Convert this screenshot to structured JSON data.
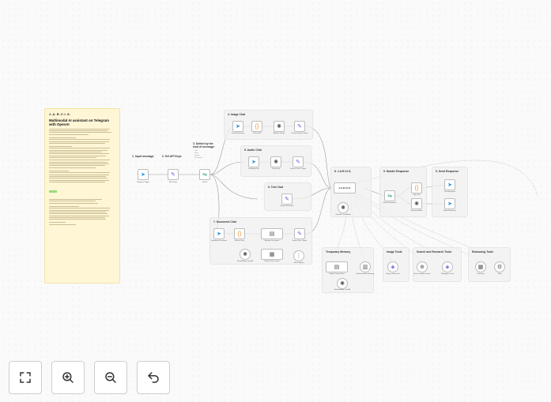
{
  "note": {
    "brand": "J.A.R.V.I.S.",
    "title": "Multimodal AI assistant on Telegram with OpenAI"
  },
  "sections": {
    "input_message": "1. Input message",
    "set_api_keys": "2. Set API Keys",
    "switch": "3. Switch by the kind of message:",
    "image_chat": "4. Image Chat",
    "audio_chat": "5. Audio Chat",
    "text_chat": "6. Text Chat",
    "document_chat": "7. Document Chat",
    "jarvis": "8. J.A.R.V.I.S.",
    "handle_response": "9. Handle Response",
    "send_response": "9. Send Response",
    "temporary_memory": "Temporary Memory",
    "image_tools": "Image Tools",
    "search_tools": "Search and Research Tools",
    "reasoning_tools": "Reasoning Tools"
  },
  "switch_options": [
    "Text",
    "Voice",
    "Image",
    "Document"
  ],
  "nodes": {
    "telegram_trigger": "Telegram Trigger",
    "set_api": "API Setup",
    "switch": "Switch",
    "download_image": "Download Image",
    "to_base64": "To Base64",
    "analyze_image": "Analyze Image",
    "format_image": "Format Image Output",
    "get_audio": "Get Audio File",
    "transcribe": "Transcribe",
    "format_audio": "Format Voice Output",
    "format_text": "Format Text Input",
    "download_document": "Download Document",
    "extract_doc": "Extract Data",
    "analyze_doc": "Analyze Document",
    "format_doc": "Format Doc Output",
    "embeddings": "Embeddings OpenAI",
    "default_loader": "Default Data Loader",
    "token_splitter": "Token Splitter",
    "jarvis_agent": "J.A.R.V.I.S.",
    "openai_model": "OpenAI Chat Model",
    "switch_resp": "Switch Response",
    "split_text": "Split Text",
    "generate_audio": "Generate Audio",
    "text_response": "Text Response",
    "audio_response": "Audio Response",
    "vector_store": "Simple Vector Store",
    "window_memory": "Window Buffer Memory",
    "embeddings2": "Embeddings OpenAI",
    "image_generation": "Image Generation",
    "brave_search": "Brave Google Search",
    "webpage_to_text": "Webpage to text",
    "calculator": "Calculator",
    "think": "Think"
  },
  "colors": {
    "note_bg": "#fff6d6",
    "telegram": "#2a8fd8",
    "code": "#f08a24",
    "openai": "#555555",
    "tool": "#7657d9"
  },
  "controls": [
    {
      "name": "fit-view-icon"
    },
    {
      "name": "zoom-in-icon"
    },
    {
      "name": "zoom-out-icon"
    },
    {
      "name": "undo-icon"
    }
  ]
}
